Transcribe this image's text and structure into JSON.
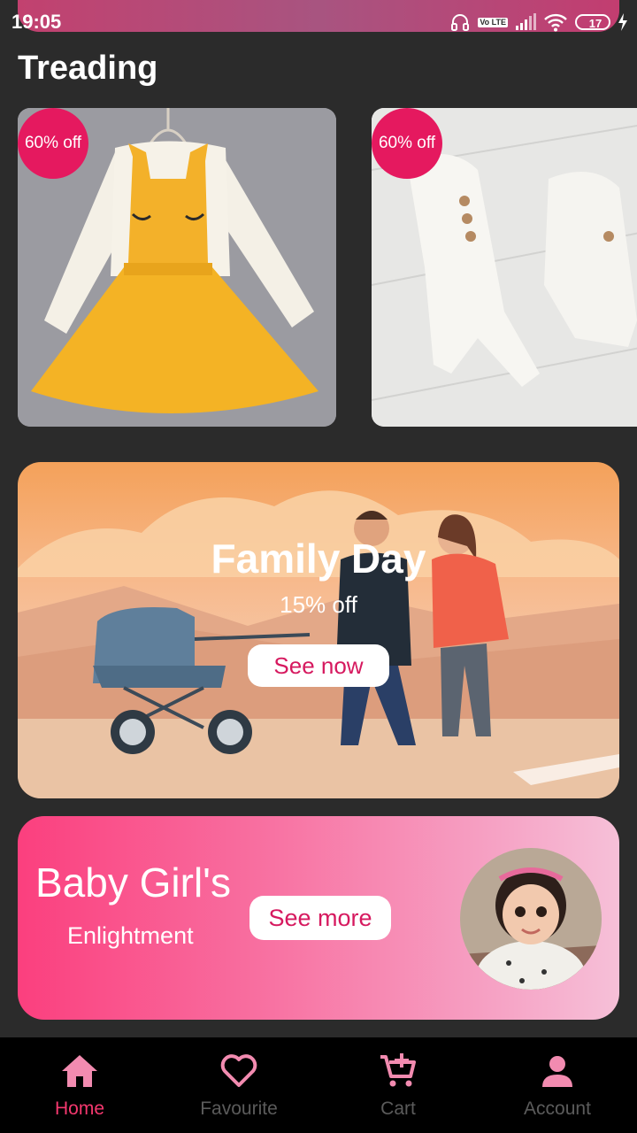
{
  "status_bar": {
    "time": "19:05",
    "battery": "17",
    "icons": [
      "headphones-icon",
      "volte-icon",
      "signal-icon",
      "wifi-icon",
      "battery-icon",
      "charging-icon"
    ],
    "lte_label": "Vo LTE"
  },
  "section_title": "Treading",
  "trending": [
    {
      "discount": "60% off",
      "image": "yellow-pinafore-dress"
    },
    {
      "discount": "60% off",
      "image": "white-knit-romper"
    }
  ],
  "family_banner": {
    "title": "Family Day",
    "subtitle": "15% off",
    "button": "See now"
  },
  "girl_banner": {
    "title": "Baby Girl's",
    "subtitle": "Enlightment",
    "button": "See more"
  },
  "bottom_nav": [
    {
      "label": "Home",
      "icon": "home-icon",
      "active": true
    },
    {
      "label": "Favourite",
      "icon": "heart-icon",
      "active": false
    },
    {
      "label": "Cart",
      "icon": "cart-add-icon",
      "active": false
    },
    {
      "label": "Account",
      "icon": "person-icon",
      "active": false
    }
  ],
  "colors": {
    "accent": "#e5195f",
    "nav_active": "#f5386f",
    "nav_inactive": "#5b5b5b",
    "nav_icon": "#f28bb0",
    "background": "#2b2b2b"
  }
}
